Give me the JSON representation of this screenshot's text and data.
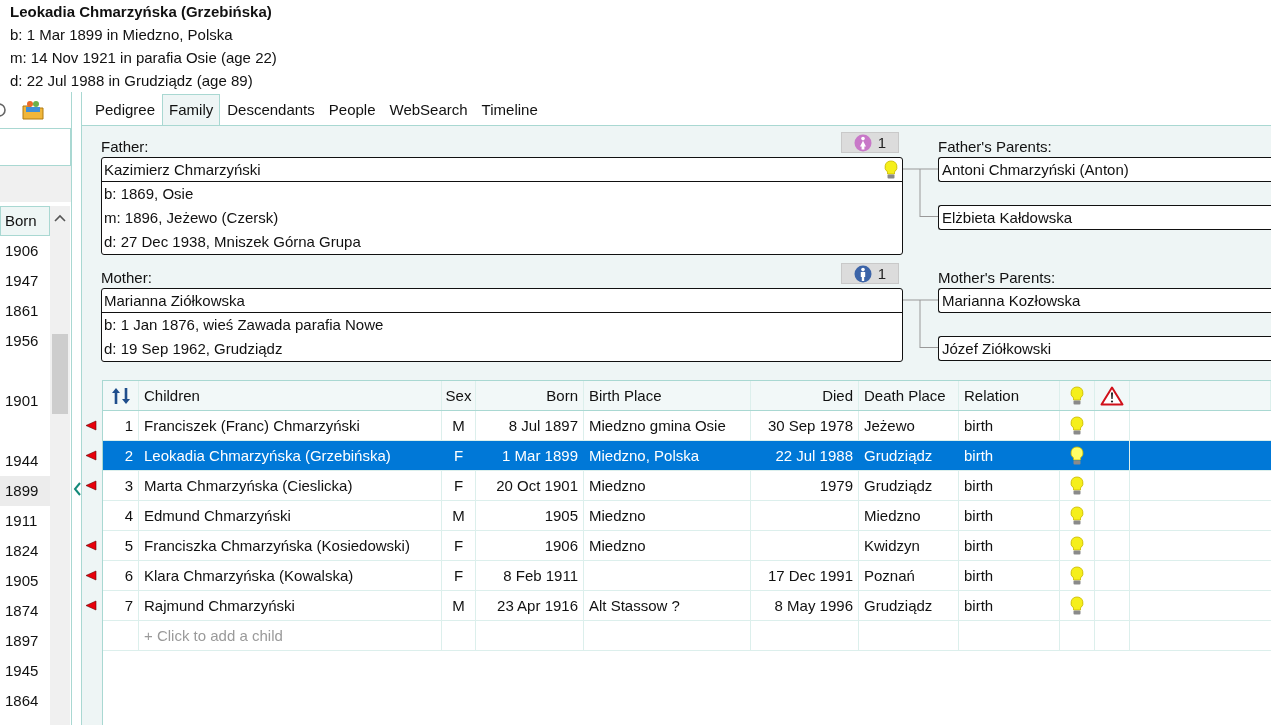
{
  "person": {
    "name": "Leokadia Chmarzyńska (Grzebińska)",
    "lines": [
      "b: 1 Mar 1899 in Miedzno, Polska",
      "m: 14 Nov 1921 in parafia Osie (age 22)",
      "d: 22 Jul 1988 in Grudziądz (age 89)"
    ]
  },
  "sidebar": {
    "column": "Born",
    "rows": [
      {
        "born": "1906",
        "selected": false
      },
      {
        "born": "1947",
        "selected": false
      },
      {
        "born": "1861",
        "selected": false
      },
      {
        "born": "1956",
        "selected": false
      },
      {
        "selected": false
      },
      {
        "born": "1901",
        "selected": false
      },
      {
        "selected": false
      },
      {
        "born": "1944",
        "selected": false
      },
      {
        "born": "1899",
        "selected": true
      },
      {
        "born": "1911",
        "selected": false
      },
      {
        "born": "1824",
        "selected": false
      },
      {
        "born": "1905",
        "selected": false
      },
      {
        "born": "1874",
        "selected": false
      },
      {
        "born": "1897",
        "selected": false
      },
      {
        "born": "1945",
        "selected": false
      },
      {
        "born": "1864",
        "selected": false
      }
    ]
  },
  "tabs": [
    {
      "label": "Pedigree",
      "selected": false
    },
    {
      "label": "Family",
      "selected": true
    },
    {
      "label": "Descendants",
      "selected": false
    },
    {
      "label": "People",
      "selected": false
    },
    {
      "label": "WebSearch",
      "selected": false
    },
    {
      "label": "Timeline",
      "selected": false
    }
  ],
  "parents": [
    {
      "label": "Father:",
      "badge": {
        "kind": "female",
        "count": "1"
      },
      "name": "Kazimierz Chmarzyński",
      "hint": true,
      "lines": [
        "b: 1869, Osie",
        "m: 1896, Jeżewo (Czersk)",
        "d: 27 Dec 1938, Mniszek Górna Grupa"
      ],
      "grandparents": {
        "label": "Father's Parents:",
        "names": [
          "Antoni Chmarzyński (Anton)",
          "Elżbieta Kałdowska"
        ]
      }
    },
    {
      "label": "Mother:",
      "badge": {
        "kind": "male",
        "count": "1"
      },
      "name": "Marianna Ziółkowska",
      "hint": false,
      "lines": [
        "b: 1 Jan 1876, wieś Zawada parafia Nowe",
        "d: 19 Sep 1962, Grudziądz"
      ],
      "grandparents": {
        "label": "Mother's Parents:",
        "names": [
          "Marianna Kozłowska",
          "Józef Ziółkowski"
        ]
      }
    }
  ],
  "children": {
    "columns": [
      {
        "kind": "sort"
      },
      {
        "kind": "text",
        "label": "Children"
      },
      {
        "kind": "text",
        "label": "Sex"
      },
      {
        "kind": "text",
        "label": "Born"
      },
      {
        "kind": "text",
        "label": "Birth Place"
      },
      {
        "kind": "text",
        "label": "Died"
      },
      {
        "kind": "text",
        "label": "Death Place"
      },
      {
        "kind": "text",
        "label": "Relation"
      },
      {
        "kind": "hint"
      },
      {
        "kind": "warning"
      }
    ],
    "rows": [
      {
        "number": "1",
        "name": "Franciszek (Franc) Chmarzyński",
        "sex": "M",
        "born": "8 Jul 1897",
        "birth_place": "Miedzno gmina Osie",
        "died": "30 Sep 1978",
        "death_place": "Jeżewo",
        "relation": "birth",
        "hint": true,
        "flagged": true,
        "selected": false
      },
      {
        "number": "2",
        "name": "Leokadia Chmarzyńska (Grzebińska)",
        "sex": "F",
        "born": "1 Mar 1899",
        "birth_place": "Miedzno, Polska",
        "died": "22 Jul 1988",
        "death_place": "Grudziądz",
        "relation": "birth",
        "hint": true,
        "flagged": true,
        "selected": true
      },
      {
        "number": "3",
        "name": "Marta Chmarzyńska (Cieslicka)",
        "sex": "F",
        "born": "20 Oct 1901",
        "birth_place": "Miedzno",
        "died": "1979",
        "death_place": "Grudziądz",
        "relation": "birth",
        "hint": true,
        "flagged": true,
        "selected": false
      },
      {
        "number": "4",
        "name": "Edmund Chmarzyński",
        "sex": "M",
        "born": "1905",
        "birth_place": "Miedzno",
        "death_place": "Miedzno",
        "relation": "birth",
        "hint": true,
        "flagged": false,
        "selected": false
      },
      {
        "number": "5",
        "name": "Franciszka Chmarzyńska (Kosiedowski)",
        "sex": "F",
        "born": "1906",
        "birth_place": "Miedzno",
        "death_place": "Kwidzyn",
        "relation": "birth",
        "hint": true,
        "flagged": true,
        "selected": false
      },
      {
        "number": "6",
        "name": "Klara Chmarzyńska (Kowalska)",
        "sex": "F",
        "born": "8 Feb 1911",
        "died": "17 Dec 1991",
        "death_place": "Poznań",
        "relation": "birth",
        "hint": true,
        "flagged": true,
        "selected": false
      },
      {
        "number": "7",
        "name": "Rajmund Chmarzyński",
        "sex": "M",
        "born": "23 Apr 1916",
        "birth_place": "Alt Stassow ?",
        "died": "8 May 1996",
        "death_place": "Grudziądz",
        "relation": "birth",
        "hint": true,
        "flagged": true,
        "selected": false
      }
    ],
    "add_row": "+ Click to add a child"
  }
}
